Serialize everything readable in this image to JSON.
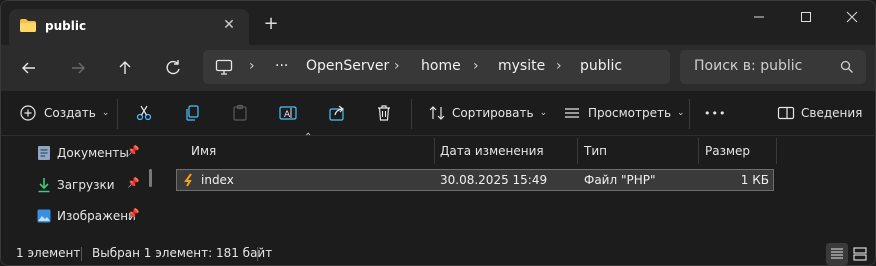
{
  "colors": {
    "folder": "#f5c04b",
    "accent": "#4cc2ff",
    "php_icon": "#f0a21d",
    "delete": "#ffffff"
  },
  "titlebar": {
    "tab_title": "public",
    "tab_icon": "folder-icon",
    "close_glyph": "✕",
    "new_tab_glyph": "+"
  },
  "address": {
    "breadcrumbs": [
      "OpenServer",
      "home",
      "mysite",
      "public"
    ],
    "ellipsis": "···"
  },
  "search": {
    "placeholder": "Поиск в: public"
  },
  "commands": {
    "create": "Создать",
    "sort": "Сортировать",
    "view": "Просмотреть",
    "more": "•••",
    "details": "Сведения"
  },
  "sidebar": {
    "items": [
      {
        "label": "Документы",
        "icon": "documents-icon"
      },
      {
        "label": "Загрузки",
        "icon": "downloads-icon"
      },
      {
        "label": "Изображени",
        "icon": "images-icon"
      }
    ]
  },
  "columns": {
    "name": "Имя",
    "date": "Дата изменения",
    "type": "Тип",
    "size": "Размер"
  },
  "files": [
    {
      "name": "index",
      "date": "30.08.2025 15:49",
      "type": "Файл \"PHP\"",
      "size": "1 КБ",
      "icon": "php-file-icon",
      "selected": true
    }
  ],
  "status": {
    "count": "1 элемент",
    "selection": "Выбран 1 элемент: 181 байт"
  }
}
